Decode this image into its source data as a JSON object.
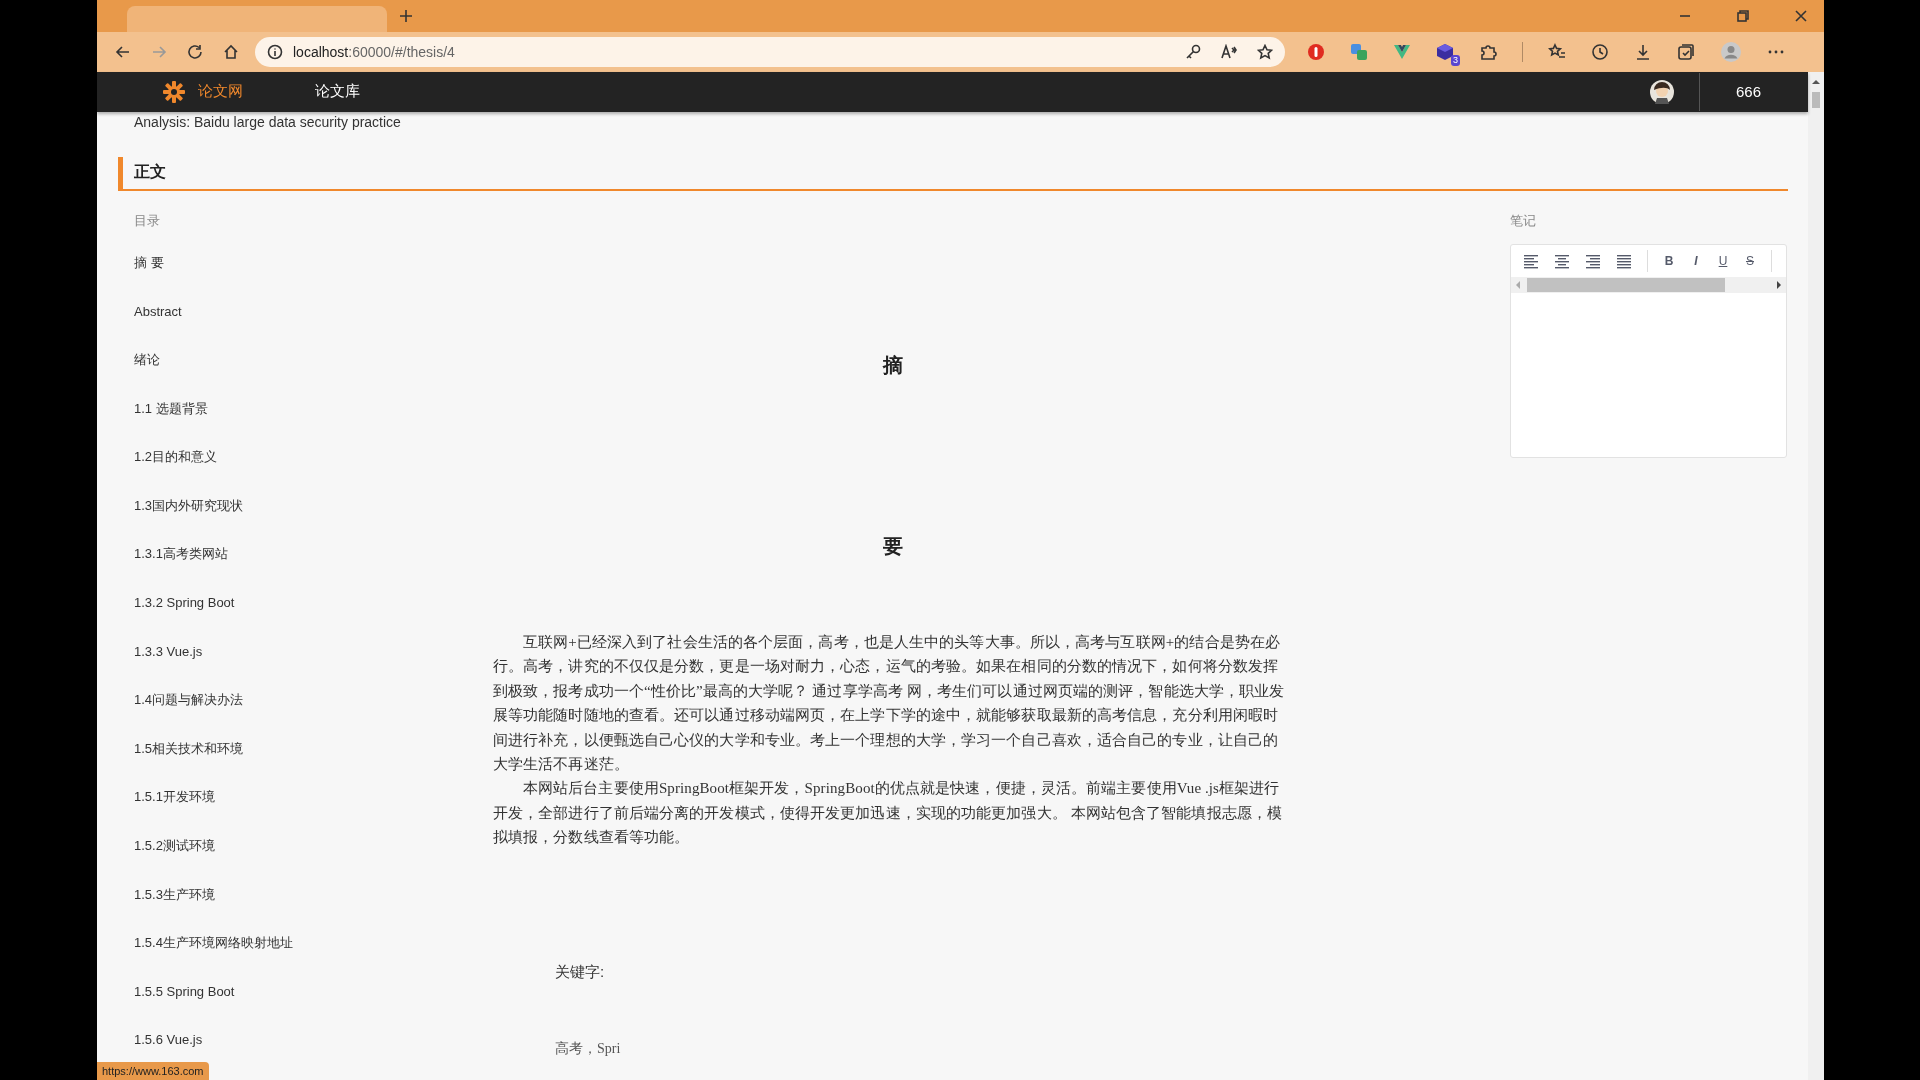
{
  "browser": {
    "url_host": "localhost",
    "url_rest": ":60000/#/thesis/4",
    "extension_badge": "3"
  },
  "site_nav": {
    "brand": "论文网",
    "links": [
      {
        "label": "论文库",
        "selected": false
      }
    ],
    "score": "666"
  },
  "subtitle": "Analysis: Baidu large data security practice",
  "section_title": "正文",
  "toc": {
    "label": "目录",
    "items": [
      "摘 要",
      "Abstract",
      "绪论",
      "1.1 选题背景",
      "1.2目的和意义",
      "1.3国内外研究现状",
      "1.3.1高考类网站",
      "1.3.2 Spring Boot",
      "1.3.3 Vue.js",
      "1.4问题与解决办法",
      "1.5相关技术和环境",
      "1.5.1开发环境",
      "1.5.2测试环境",
      "1.5.3生产环境",
      "1.5.4生产环境网络映射地址",
      "1.5.5 Spring Boot",
      "1.5.6 Vue.js"
    ]
  },
  "article": {
    "heading": [
      "摘",
      "要"
    ],
    "paragraphs": [
      "互联网+已经深入到了社会生活的各个层面，高考，也是人生中的头等大事。所以，高考与互联网+的结合是势在必行。高考，讲究的不仅仅是分数，更是一场对耐力，心态，运气的考验。如果在相同的分数的情况下，如何将分数发挥到极致，报考成功一个“性价比”最高的大学呢？ 通过享学高考 网，考生们可以通过网页端的测评，智能选大学，职业发展等功能随时随地的查看。还可以通过移动端网页，在上学下学的途中，就能够获取最新的高考信息，充分利用闲暇时间进行补充，以便甄选自己心仪的大学和专业。考上一个理想的大学，学习一个自己喜欢，适合自己的专业，让自己的大学生活不再迷茫。",
      "本网站后台主要使用SpringBoot框架开发，SpringBoot的优点就是快速，便捷，灵活。前端主要使用Vue .js框架进行开发，全部进行了前后端分离的开发模式，使得开发更加迅速，实现的功能更加强大。 本网站包含了智能填报志愿，模拟填报，分数线查看等功能。"
    ],
    "keywords_label": "关键字:",
    "keywords": "高考，Spri"
  },
  "notes": {
    "label": "笔记",
    "toolbar": [
      {
        "kind": "align-left"
      },
      {
        "kind": "align-center"
      },
      {
        "kind": "align-right"
      },
      {
        "kind": "justify"
      },
      {
        "kind": "bold",
        "glyph": "B"
      },
      {
        "kind": "italic",
        "glyph": "I"
      },
      {
        "kind": "underline",
        "glyph": "U"
      },
      {
        "kind": "strike",
        "glyph": "S"
      }
    ]
  },
  "status_link": "https://www.163.com"
}
